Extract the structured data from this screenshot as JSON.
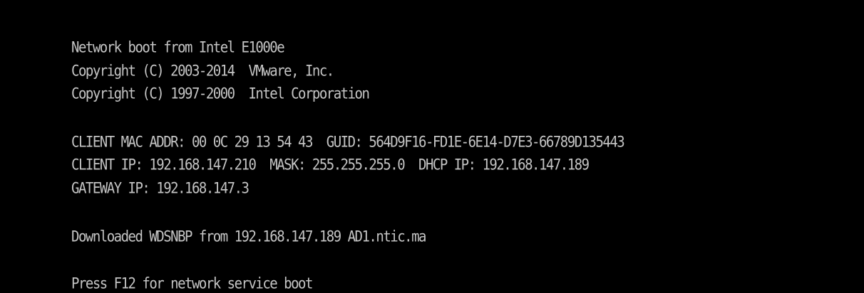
{
  "console": {
    "colors": {
      "background": "#000000",
      "text": "#c4c4c4"
    },
    "lines": [
      "Network boot from Intel E1000e",
      "Copyright (C) 2003-2014  VMware, Inc.",
      "Copyright (C) 1997-2000  Intel Corporation",
      "CLIENT MAC ADDR: 00 0C 29 13 54 43  GUID: 564D9F16-FD1E-6E14-D7E3-66789D135443",
      "CLIENT IP: 192.168.147.210  MASK: 255.255.255.0  DHCP IP: 192.168.147.189",
      "GATEWAY IP: 192.168.147.3",
      "Downloaded WDSNBP from 192.168.147.189 AD1.ntic.ma",
      "Press F12 for network service boot"
    ]
  }
}
